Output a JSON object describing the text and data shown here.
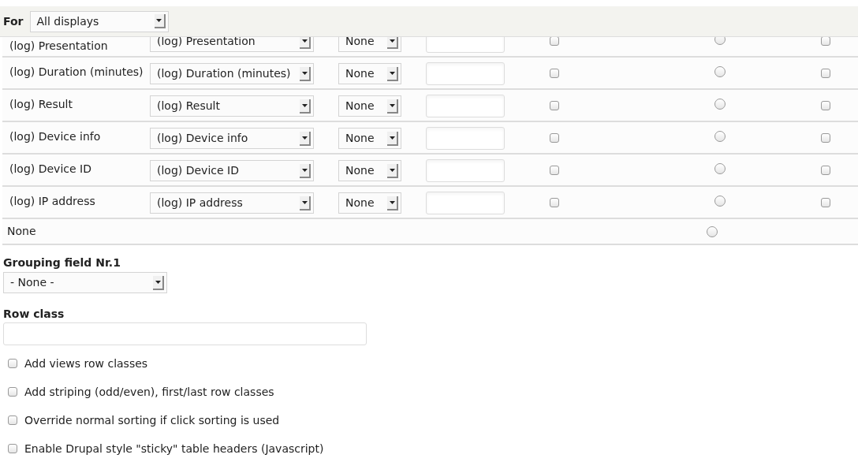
{
  "for_bar": {
    "label": "For",
    "select": "All displays"
  },
  "rows": [
    {
      "label": "(log) Presentation",
      "field": "(log) Presentation",
      "option": "None",
      "text": "",
      "checked": false,
      "selected": false,
      "flag": false
    },
    {
      "label": "(log) Duration (minutes)",
      "field": "(log) Duration (minutes)",
      "option": "None",
      "text": "",
      "checked": false,
      "selected": false,
      "flag": false
    },
    {
      "label": "(log) Result",
      "field": "(log) Result",
      "option": "None",
      "text": "",
      "checked": false,
      "selected": false,
      "flag": false
    },
    {
      "label": "(log) Device info",
      "field": "(log) Device info",
      "option": "None",
      "text": "",
      "checked": false,
      "selected": false,
      "flag": false
    },
    {
      "label": "(log) Device ID",
      "field": "(log) Device ID",
      "option": "None",
      "text": "",
      "checked": false,
      "selected": false,
      "flag": false
    },
    {
      "label": "(log) IP address",
      "field": "(log) IP address",
      "option": "None",
      "text": "",
      "checked": false,
      "selected": false,
      "flag": false
    }
  ],
  "none_row": {
    "label": "None",
    "selected": false
  },
  "grouping": {
    "label": "Grouping field Nr.1",
    "select": "- None -"
  },
  "row_class": {
    "label": "Row class"
  },
  "options": [
    {
      "label": "Add views row classes",
      "checked": false
    },
    {
      "label": "Add striping (odd/even), first/last row classes",
      "checked": false
    },
    {
      "label": "Override normal sorting if click sorting is used",
      "checked": false
    },
    {
      "label": "Enable Drupal style \"sticky\" table headers (Javascript)",
      "checked": false
    }
  ]
}
